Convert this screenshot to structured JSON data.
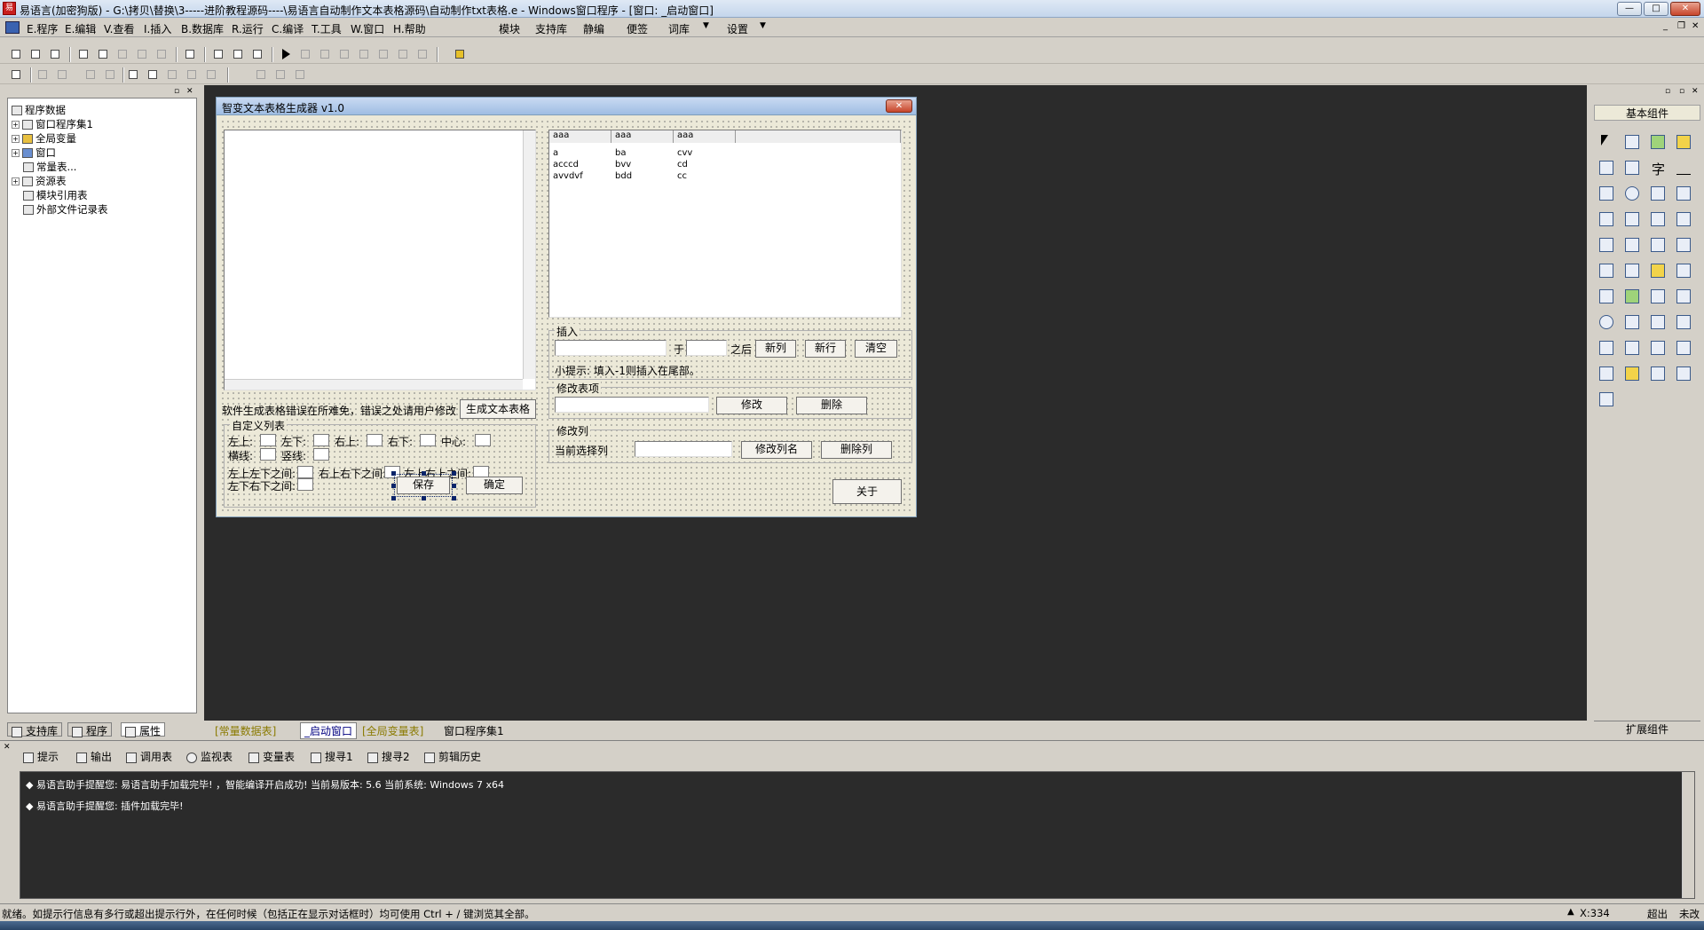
{
  "window": {
    "title": "易语言(加密狗版) - G:\\拷贝\\替换\\3-----进阶教程源码----\\易语言自动制作文本表格源码\\自动制作txt表格.e - Windows窗口程序 - [窗口: _启动窗口]",
    "app_icon_text": "易"
  },
  "menu": {
    "items": [
      "E.程序",
      "E.编辑",
      "V.查看",
      "I.插入",
      "B.数据库",
      "R.运行",
      "C.编译",
      "T.工具",
      "W.窗口",
      "H.帮助"
    ],
    "right_items": [
      "模块",
      "支持库",
      "静编",
      "便签",
      "词库",
      "设置"
    ]
  },
  "left_panel": {
    "tree": [
      {
        "label": "程序数据",
        "expander": "",
        "level": 0
      },
      {
        "label": "窗口程序集1",
        "expander": "+",
        "level": 1
      },
      {
        "label": "全局变量",
        "expander": "+",
        "level": 1
      },
      {
        "label": "窗口",
        "expander": "+",
        "level": 1
      },
      {
        "label": "常量表...",
        "expander": "",
        "level": 1
      },
      {
        "label": "资源表",
        "expander": "+",
        "level": 1
      },
      {
        "label": "模块引用表",
        "expander": "",
        "level": 1
      },
      {
        "label": "外部文件记录表",
        "expander": "",
        "level": 1
      }
    ],
    "tabs": [
      "支持库",
      "程序",
      "属性"
    ]
  },
  "form": {
    "title": "智变文本表格生成器 v1.0",
    "grid": {
      "headers": [
        "aaa",
        "aaa",
        "aaa"
      ],
      "rows": [
        [
          "a",
          "ba",
          "cvv"
        ],
        [
          "acccd",
          "bvv",
          "cd"
        ],
        [
          "avvdvf",
          "bdd",
          "cc"
        ]
      ]
    },
    "insert_group": {
      "label": "插入",
      "yu": "于",
      "after": "之后",
      "new_col": "新列",
      "new_row": "新行",
      "clear": "清空",
      "hint": "小提示: 填入-1则插入在尾部。"
    },
    "modify_item_group": {
      "label": "修改表项",
      "modify": "修改",
      "delete": "删除"
    },
    "modify_col_group": {
      "label": "修改列",
      "current": "当前选择列",
      "rename": "修改列名",
      "delete_col": "删除列"
    },
    "close": "关于",
    "note": "软件生成表格错误在所难免，错误之处请用户修改",
    "generate": "生成文本表格",
    "custom_group": {
      "label": "自定义列表",
      "top_left": "左上:",
      "bottom_left": "左下:",
      "top_right": "右上:",
      "bottom_right": "右下:",
      "center": "中心:",
      "horizontal": "横线:",
      "vertical": "竖线:",
      "lr_top_bottom": "左上左下之间:",
      "lr_bottom": "左下右下之间:",
      "tr_br": "右上右下之间:",
      "tl_tr": "左上右上之间:",
      "save": "保存",
      "ok": "确定"
    }
  },
  "editor_tabs": [
    "[常量数据表]",
    "_启动窗口",
    "[全局变量表]",
    "窗口程序集1"
  ],
  "palette": {
    "title": "基本组件",
    "footer": "扩展组件"
  },
  "output": {
    "tabs": [
      "提示",
      "输出",
      "调用表",
      "监视表",
      "变量表",
      "搜寻1",
      "搜寻2",
      "剪辑历史"
    ],
    "lines": [
      "◆ 易语言助手提醒您: 易语言助手加载完毕! ，智能编译开启成功! 当前易版本: 5.6 当前系统: Windows 7 x64",
      "◆ 易语言助手提醒您: 插件加载完毕!"
    ]
  },
  "status": {
    "text": "就绪。如提示行信息有多行或超出提示行外，在任何时候（包括正在显示对话框时）均可使用 Ctrl + / 键浏览其全部。",
    "coord": "X:334",
    "mode": "超出",
    "state": "未改"
  }
}
